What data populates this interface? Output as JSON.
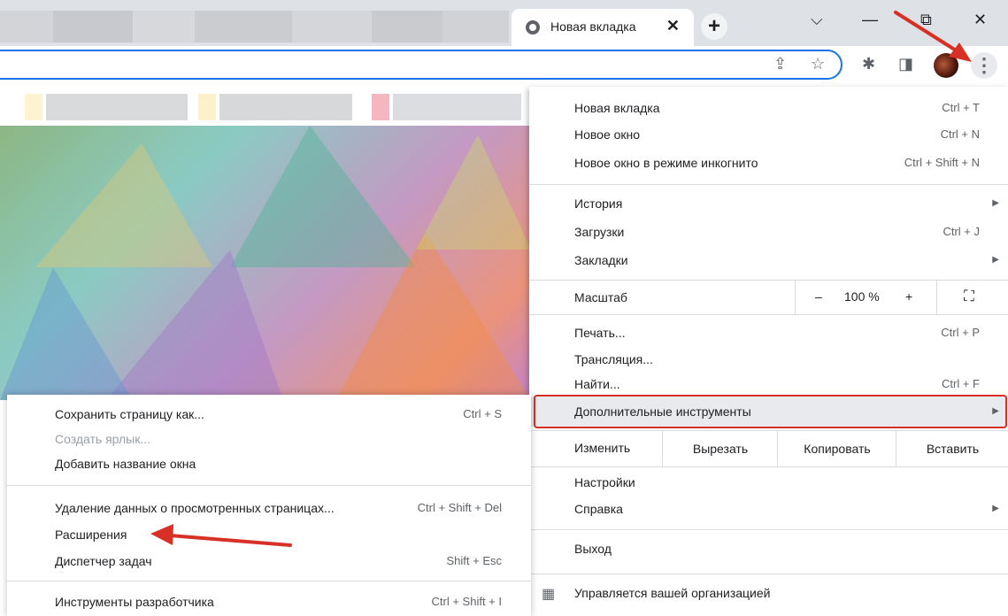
{
  "tab": {
    "title": "Новая вкладка",
    "close": "✕",
    "new_tab": "+"
  },
  "window_controls": {
    "dropdown": "⌵",
    "minimize": "—",
    "restore": "⧉",
    "close": "✕"
  },
  "toolbar": {
    "share_icon": "⇪",
    "star_icon": "☆",
    "extensions_icon": "✱",
    "sidepanel_icon": "◨",
    "menu_icon": "⋮"
  },
  "menu": {
    "items_group1": [
      {
        "label": "Новая вкладка",
        "shortcut": "Ctrl + T"
      },
      {
        "label": "Новое окно",
        "shortcut": "Ctrl + N"
      },
      {
        "label": "Новое окно в режиме инкогнито",
        "shortcut": "Ctrl + Shift + N"
      }
    ],
    "items_group2": [
      {
        "label": "История",
        "shortcut": "",
        "submenu": true
      },
      {
        "label": "Загрузки",
        "shortcut": "Ctrl + J"
      },
      {
        "label": "Закладки",
        "shortcut": "",
        "submenu": true
      }
    ],
    "zoom": {
      "label": "Масштаб",
      "minus": "–",
      "value": "100 %",
      "plus": "+",
      "fullscreen_icon": "⛶"
    },
    "items_group4": [
      {
        "label": "Печать...",
        "shortcut": "Ctrl + P"
      },
      {
        "label": "Трансляция...",
        "shortcut": ""
      },
      {
        "label": "Найти...",
        "shortcut": "Ctrl + F"
      }
    ],
    "more_tools": {
      "label": "Дополнительные инструменты",
      "arrow": "▶"
    },
    "edit": {
      "label": "Изменить",
      "cut": "Вырезать",
      "copy": "Копировать",
      "paste": "Вставить"
    },
    "items_group7": [
      {
        "label": "Настройки",
        "shortcut": ""
      },
      {
        "label": "Справка",
        "shortcut": "",
        "submenu": true
      }
    ],
    "exit": "Выход",
    "managed": {
      "icon": "▦",
      "label": "Управляется вашей организацией"
    }
  },
  "submenu": {
    "items": [
      {
        "label": "Сохранить страницу как...",
        "shortcut": "Ctrl + S",
        "disabled": false
      },
      {
        "label": "Создать ярлык...",
        "shortcut": "",
        "disabled": true
      },
      {
        "label": "Добавить название окна",
        "shortcut": "",
        "disabled": false
      }
    ],
    "items2": [
      {
        "label": "Удаление данных о просмотренных страницах...",
        "shortcut": "Ctrl + Shift + Del"
      },
      {
        "label": "Расширения",
        "shortcut": ""
      },
      {
        "label": "Диспетчер задач",
        "shortcut": "Shift + Esc"
      }
    ],
    "dev_tools": {
      "label": "Инструменты разработчика",
      "shortcut": "Ctrl + Shift + I"
    }
  },
  "colors": {
    "annotation_red": "#d93025",
    "accent_blue": "#1a73e8"
  }
}
